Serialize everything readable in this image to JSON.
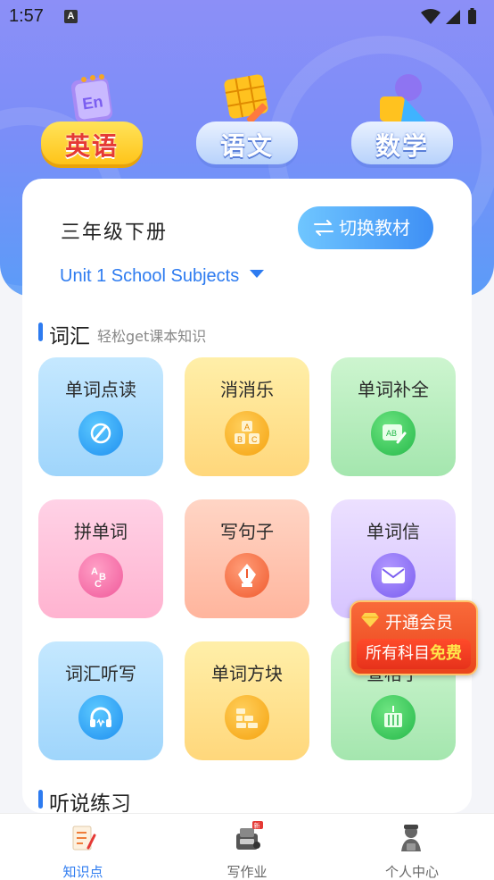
{
  "status_bar": {
    "time": "1:57",
    "notification_glyph": "A"
  },
  "subjects": [
    {
      "label": "英语",
      "icon": "english-book-icon",
      "active": true
    },
    {
      "label": "语文",
      "icon": "chinese-grid-icon",
      "active": false
    },
    {
      "label": "数学",
      "icon": "math-shapes-icon",
      "active": false
    }
  ],
  "textbook": {
    "grade": "三年级下册",
    "switch_label": "切换教材",
    "unit": "Unit 1 School Subjects"
  },
  "sections": {
    "vocab": {
      "title": "词汇",
      "subtitle": "轻松get课本知识"
    },
    "listening": {
      "title": "听说练习"
    }
  },
  "tiles": [
    {
      "label": "单词点读",
      "icon": "pen-read-icon"
    },
    {
      "label": "消消乐",
      "icon": "abc-blocks-icon"
    },
    {
      "label": "单词补全",
      "icon": "ab-board-icon"
    },
    {
      "label": "拼单词",
      "icon": "abc-letters-icon"
    },
    {
      "label": "写句子",
      "icon": "fountain-pen-icon"
    },
    {
      "label": "单词信",
      "icon": "envelope-icon"
    },
    {
      "label": "词汇听写",
      "icon": "headphones-icon"
    },
    {
      "label": "单词方块",
      "icon": "brick-wall-icon"
    },
    {
      "label": "查格子",
      "icon": "grid-machine-icon"
    }
  ],
  "vip": {
    "title": "开通会员",
    "text": "所有科目",
    "highlight": "免费"
  },
  "bottom_nav": [
    {
      "label": "知识点",
      "icon": "notebook-icon",
      "active": true
    },
    {
      "label": "写作业",
      "icon": "homework-machine-icon",
      "badge": "新",
      "active": false
    },
    {
      "label": "个人中心",
      "icon": "profile-icon",
      "active": false
    }
  ],
  "colors": {
    "accent": "#2d7bf0",
    "hero_top": "#8c8ff7",
    "hero_bottom": "#5b9cf8",
    "vip": "#e9451c"
  }
}
